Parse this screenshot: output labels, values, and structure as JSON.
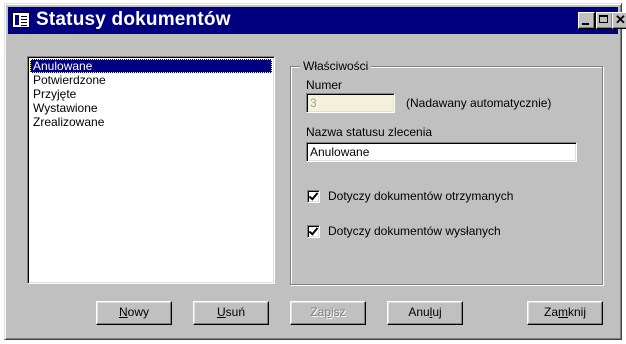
{
  "window": {
    "title": "Statusy dokumentów",
    "title_icon": "app-window-icon"
  },
  "list": {
    "items": [
      {
        "label": "Anulowane",
        "selected": true
      },
      {
        "label": "Potwierdzone",
        "selected": false
      },
      {
        "label": "Przyjęte",
        "selected": false
      },
      {
        "label": "Wystawione",
        "selected": false
      },
      {
        "label": "Zrealizowane",
        "selected": false
      }
    ]
  },
  "properties": {
    "group_label": "Właściwości",
    "numer_label": "Numer",
    "numer_value": "3",
    "numer_hint": "(Nadawany automatycznie)",
    "name_label": "Nazwa statusu zlecenia",
    "name_value": "Anulowane",
    "checkbox_received_label": "Dotyczy dokumentów otrzymanych",
    "checkbox_received_checked": true,
    "checkbox_sent_label": "Dotyczy dokumentów wysłanych",
    "checkbox_sent_checked": true
  },
  "buttons": {
    "new_prefix": "N",
    "new_rest": "owy",
    "delete_prefix": "U",
    "delete_rest": "suń",
    "save_pre": "Za",
    "save_u": "p",
    "save_rest": "isz",
    "cancel_pre": "Anu",
    "cancel_u": "l",
    "cancel_rest": "uj",
    "close_pre": "Za",
    "close_u": "m",
    "close_rest": "knij"
  },
  "colors": {
    "titlebar": "#000080",
    "face": "#c0c0c0",
    "selection": "#000080"
  }
}
